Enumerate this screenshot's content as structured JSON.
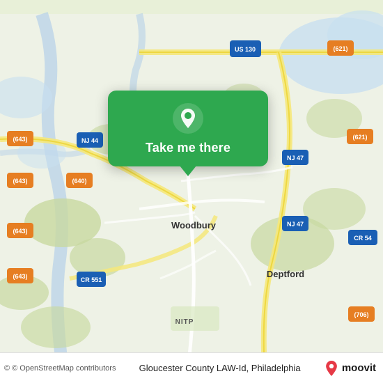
{
  "map": {
    "alt": "Map of Woodbury and Deptford area, New Jersey",
    "accent_color": "#2ea84f"
  },
  "popup": {
    "button_label": "Take me there",
    "pin_icon": "location-pin"
  },
  "bottom_bar": {
    "credit": "© OpenStreetMap contributors",
    "title": "Gloucester County LAW-Id, Philadelphia",
    "logo": "moovit"
  }
}
